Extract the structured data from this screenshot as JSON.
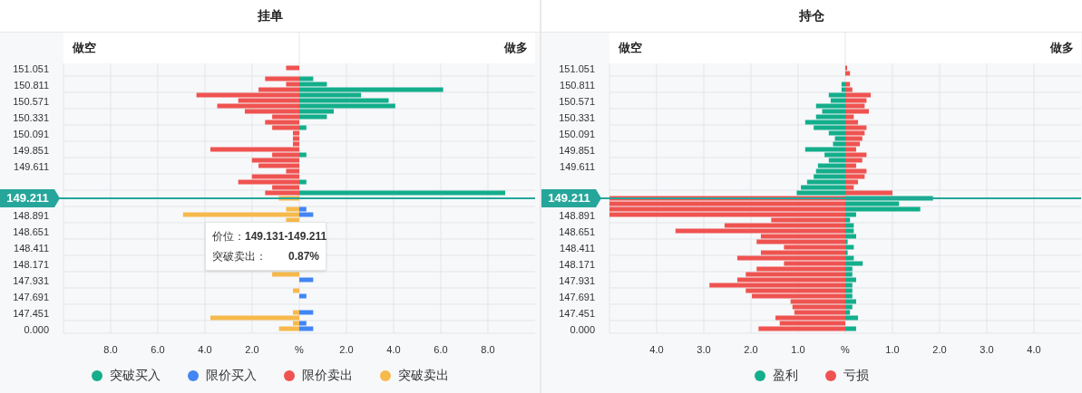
{
  "panels": [
    {
      "title": "挂单",
      "short_label": "做空",
      "long_label": "做多",
      "current_price": "149.211",
      "chart_data": {
        "type": "bar",
        "orientation": "horizontal",
        "stacked": true,
        "xlim": [
          -10,
          10
        ],
        "xticks": [
          {
            "value": -8,
            "label": "8.0"
          },
          {
            "value": -6,
            "label": "6.0"
          },
          {
            "value": -4,
            "label": "4.0"
          },
          {
            "value": -2,
            "label": "2.0"
          },
          {
            "value": 0,
            "label": "%"
          },
          {
            "value": 2,
            "label": "2.0"
          },
          {
            "value": 4,
            "label": "4.0"
          },
          {
            "value": 6,
            "label": "6.0"
          },
          {
            "value": 8,
            "label": "8.0"
          }
        ],
        "grid": true,
        "categories": [
          "151.051",
          null,
          null,
          "150.811",
          null,
          null,
          "150.571",
          null,
          null,
          "150.331",
          null,
          null,
          "150.091",
          null,
          null,
          "149.851",
          null,
          null,
          "149.611",
          null,
          null,
          null,
          null,
          null,
          null,
          null,
          null,
          "148.891",
          null,
          null,
          "148.651",
          null,
          null,
          "148.411",
          null,
          null,
          "148.171",
          null,
          null,
          "147.931",
          null,
          null,
          "147.691",
          null,
          null,
          "147.451",
          null,
          null,
          "0.000"
        ],
        "series": [
          {
            "name": "突破买入",
            "color": "#13ae8b",
            "values": [
              0,
              0,
              0.59,
              1.17,
              6.1,
              2.62,
              3.79,
              4.07,
              1.46,
              1.17,
              0,
              0.3,
              0,
              0,
              0,
              0,
              0.3,
              0,
              0,
              0,
              0,
              0.3,
              0,
              8.73,
              0,
              0,
              0,
              0,
              0,
              0,
              0,
              0,
              0,
              0,
              0,
              0,
              0,
              0,
              0,
              0,
              0,
              0,
              0,
              0,
              0,
              0,
              0,
              0,
              0
            ]
          },
          {
            "name": "限价买入",
            "color": "#4285f4",
            "values": [
              0,
              0,
              0,
              0,
              0,
              0,
              0,
              0,
              0,
              0,
              0,
              0,
              0,
              0,
              0,
              0,
              0,
              0,
              0,
              0,
              0,
              0,
              0,
              0,
              0,
              0,
              0.3,
              0.59,
              0,
              null,
              null,
              null,
              null,
              null,
              null,
              null,
              null,
              0,
              0,
              0.59,
              0,
              0,
              0.3,
              0,
              0,
              0.59,
              0,
              0.3,
              0.59
            ]
          },
          {
            "name": "限价卖出",
            "color": "#ef5350",
            "values": [
              -0.56,
              0,
              -1.45,
              -0.56,
              -1.73,
              -4.36,
              -2.59,
              -3.48,
              -2.31,
              -1.15,
              -1.45,
              -1.15,
              -0.27,
              -0.27,
              -0.27,
              -3.77,
              -1.15,
              -2.01,
              -1.73,
              -0.56,
              -2.01,
              -2.59,
              -1.15,
              -1.45,
              0,
              0,
              0,
              0,
              0,
              0,
              0,
              0,
              0,
              0,
              0,
              0,
              0,
              0,
              0,
              0,
              0,
              0,
              0,
              0,
              0,
              0,
              0,
              0,
              0
            ]
          },
          {
            "name": "突破卖出",
            "color": "#f6b94c",
            "values": [
              0,
              0,
              0,
              0,
              0,
              0,
              0,
              0,
              0,
              0,
              0,
              0,
              0,
              0,
              0,
              0,
              0,
              0,
              0,
              0,
              0,
              0,
              0,
              0,
              -0.87,
              0,
              -0.56,
              -4.93,
              -0.56,
              null,
              null,
              null,
              null,
              null,
              null,
              null,
              null,
              0,
              -1.15,
              0,
              0,
              -0.27,
              0,
              0,
              0,
              -0.27,
              -3.77,
              -0.27,
              -0.86
            ]
          }
        ]
      },
      "tooltip": {
        "rows": [
          {
            "label": "价位：",
            "value": "149.131-149.211"
          },
          {
            "label": "突破卖出：",
            "value": "0.87%"
          }
        ]
      }
    },
    {
      "title": "持仓",
      "short_label": "做空",
      "long_label": "做多",
      "current_price": "149.211",
      "chart_data": {
        "type": "bar",
        "orientation": "horizontal",
        "stacked": true,
        "xlim": [
          -5,
          5
        ],
        "xticks": [
          {
            "value": -4,
            "label": "4.0"
          },
          {
            "value": -3,
            "label": "3.0"
          },
          {
            "value": -2,
            "label": "2.0"
          },
          {
            "value": -1,
            "label": "1.0"
          },
          {
            "value": 0,
            "label": "%"
          },
          {
            "value": 1,
            "label": "1.0"
          },
          {
            "value": 2,
            "label": "2.0"
          },
          {
            "value": 3,
            "label": "3.0"
          },
          {
            "value": 4,
            "label": "4.0"
          }
        ],
        "grid": true,
        "categories": [
          "151.051",
          null,
          null,
          "150.811",
          null,
          null,
          "150.571",
          null,
          null,
          "150.331",
          null,
          null,
          "150.091",
          null,
          null,
          "149.851",
          null,
          null,
          "149.611",
          null,
          null,
          null,
          null,
          null,
          null,
          null,
          null,
          "148.891",
          null,
          null,
          "148.651",
          null,
          null,
          "148.411",
          null,
          null,
          "148.171",
          null,
          null,
          "147.931",
          null,
          null,
          "147.691",
          null,
          null,
          "147.451",
          null,
          null,
          "0.000"
        ],
        "series": [
          {
            "name": "盈利",
            "color": "#13ae8b",
            "values": [
              0,
              0,
              0,
              -0.08,
              -0.08,
              -0.35,
              -0.31,
              -0.62,
              -0.49,
              -0.62,
              -0.85,
              -0.67,
              -0.35,
              -0.22,
              -0.26,
              -0.85,
              -0.44,
              -0.35,
              -0.58,
              -0.62,
              -0.67,
              -0.81,
              -0.94,
              -1.03,
              1.86,
              1.14,
              1.59,
              0.23,
              0.1,
              0.18,
              0.18,
              0.23,
              0.05,
              0.18,
              0.05,
              0.18,
              0.37,
              0.15,
              0.15,
              0.23,
              0.15,
              0.15,
              0.15,
              0.23,
              0.15,
              0.1,
              0.27,
              0,
              0.23
            ]
          },
          {
            "name": "亏损",
            "color": "#ef5350",
            "values": [
              0.04,
              0.1,
              0,
              0.1,
              0.15,
              0.54,
              0.45,
              0.41,
              0.5,
              0.18,
              0.27,
              0.45,
              0.41,
              0.36,
              0.31,
              0.23,
              0.45,
              0.36,
              0.23,
              0.45,
              0.41,
              0.27,
              0.18,
              1.0,
              -5,
              -5,
              -5,
              -5,
              -1.57,
              -2.56,
              -3.6,
              -1.79,
              -1.88,
              -1.3,
              -1.79,
              -2.29,
              -1.3,
              -1.88,
              -2.11,
              -2.29,
              -2.88,
              -2.11,
              -1.98,
              -1.16,
              -1.12,
              -1.08,
              -1.48,
              -1.39,
              -1.84
            ]
          }
        ]
      }
    }
  ]
}
